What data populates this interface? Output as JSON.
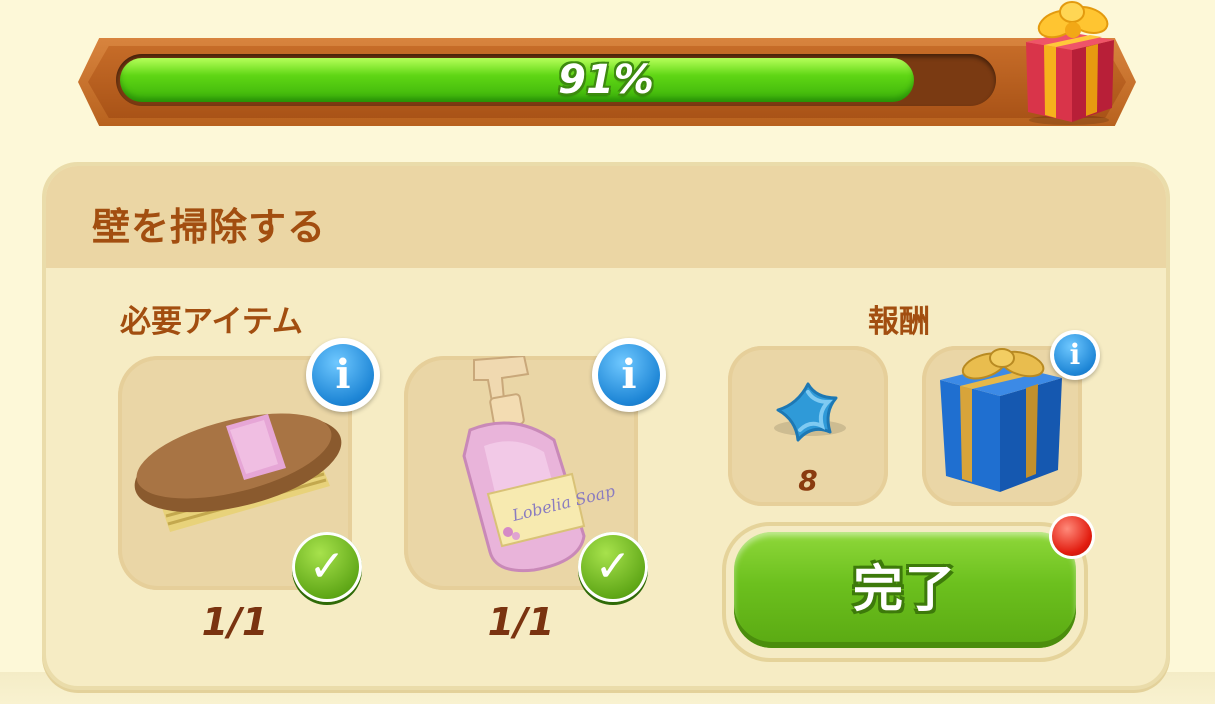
{
  "progress": {
    "percent": 91,
    "label": "91%"
  },
  "task": {
    "title": "壁を掃除する",
    "required_label": "必要アイテム",
    "reward_label": "報酬",
    "required_items": [
      {
        "icon": "brush-icon",
        "count": "1/1",
        "complete": true
      },
      {
        "icon": "soap-bottle-icon",
        "count": "1/1",
        "complete": true
      }
    ],
    "rewards": [
      {
        "icon": "blue-star-icon",
        "amount": "8"
      },
      {
        "icon": "blue-gift-box-icon"
      }
    ],
    "complete_button": "完了"
  },
  "colors": {
    "title_text": "#a24e10",
    "progress_fill": "#5fd614",
    "button_green": "#6cc01e",
    "notification": "#e21d10"
  }
}
